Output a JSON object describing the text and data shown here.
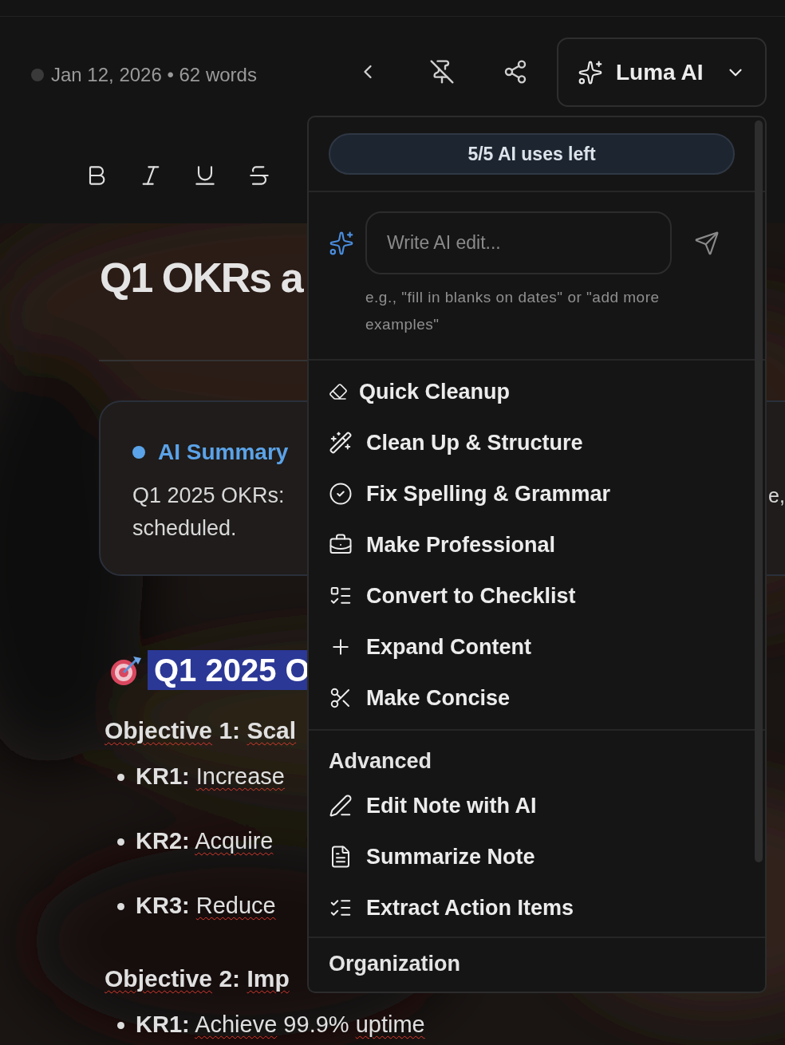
{
  "header": {
    "meta": "Jan 12, 2026 • 62 words",
    "ai_button": "Luma AI"
  },
  "document": {
    "title": "Q1 OKRs a",
    "summary": {
      "heading": "AI Summary",
      "color": "#5ba3e8",
      "line_1": "Q1 2025 OKRs:",
      "line_2": "scheduled.",
      "tail": "e,"
    },
    "heading": "Q1 2025 O",
    "lines": [
      {
        "kind": "objective",
        "segments": [
          {
            "text": "Objective",
            "flagged": true
          },
          {
            "text": " 1: ",
            "flagged": false
          },
          {
            "text": "Scal",
            "flagged": true
          }
        ]
      },
      {
        "kind": "bullet",
        "label": "KR1:",
        "segments": [
          {
            "text": "Increase",
            "flagged": true
          }
        ]
      },
      {
        "kind": "bullet",
        "label": "KR2:",
        "segments": [
          {
            "text": "Acquire",
            "flagged": true
          }
        ]
      },
      {
        "kind": "bullet",
        "label": "KR3:",
        "segments": [
          {
            "text": "Reduce",
            "flagged": true
          }
        ]
      },
      {
        "kind": "objective",
        "segments": [
          {
            "text": "Objective",
            "flagged": true
          },
          {
            "text": " 2: ",
            "flagged": false
          },
          {
            "text": "Imp",
            "flagged": true
          }
        ]
      },
      {
        "kind": "bullet",
        "label": "KR1:",
        "segments": [
          {
            "text": "Achieve",
            "flagged": true
          },
          {
            "text": " 99.9% ",
            "flagged": false
          },
          {
            "text": "uptime",
            "flagged": true
          }
        ]
      }
    ]
  },
  "ai_menu": {
    "usage": "5/5 AI uses left",
    "input": {
      "placeholder": "Write AI edit..."
    },
    "hint": "e.g., \"fill in blanks on dates\" or \"add more examples\"",
    "actions": [
      {
        "label": "Quick Cleanup"
      },
      {
        "label": "Clean Up & Structure"
      },
      {
        "label": "Fix Spelling & Grammar"
      },
      {
        "label": "Make Professional"
      },
      {
        "label": "Convert to Checklist"
      },
      {
        "label": "Expand Content"
      },
      {
        "label": "Make Concise"
      }
    ],
    "advanced_heading": "Advanced",
    "advanced": [
      {
        "label": "Edit Note with AI"
      },
      {
        "label": "Summarize Note"
      },
      {
        "label": "Extract Action Items"
      }
    ],
    "next_heading": "Organization"
  }
}
